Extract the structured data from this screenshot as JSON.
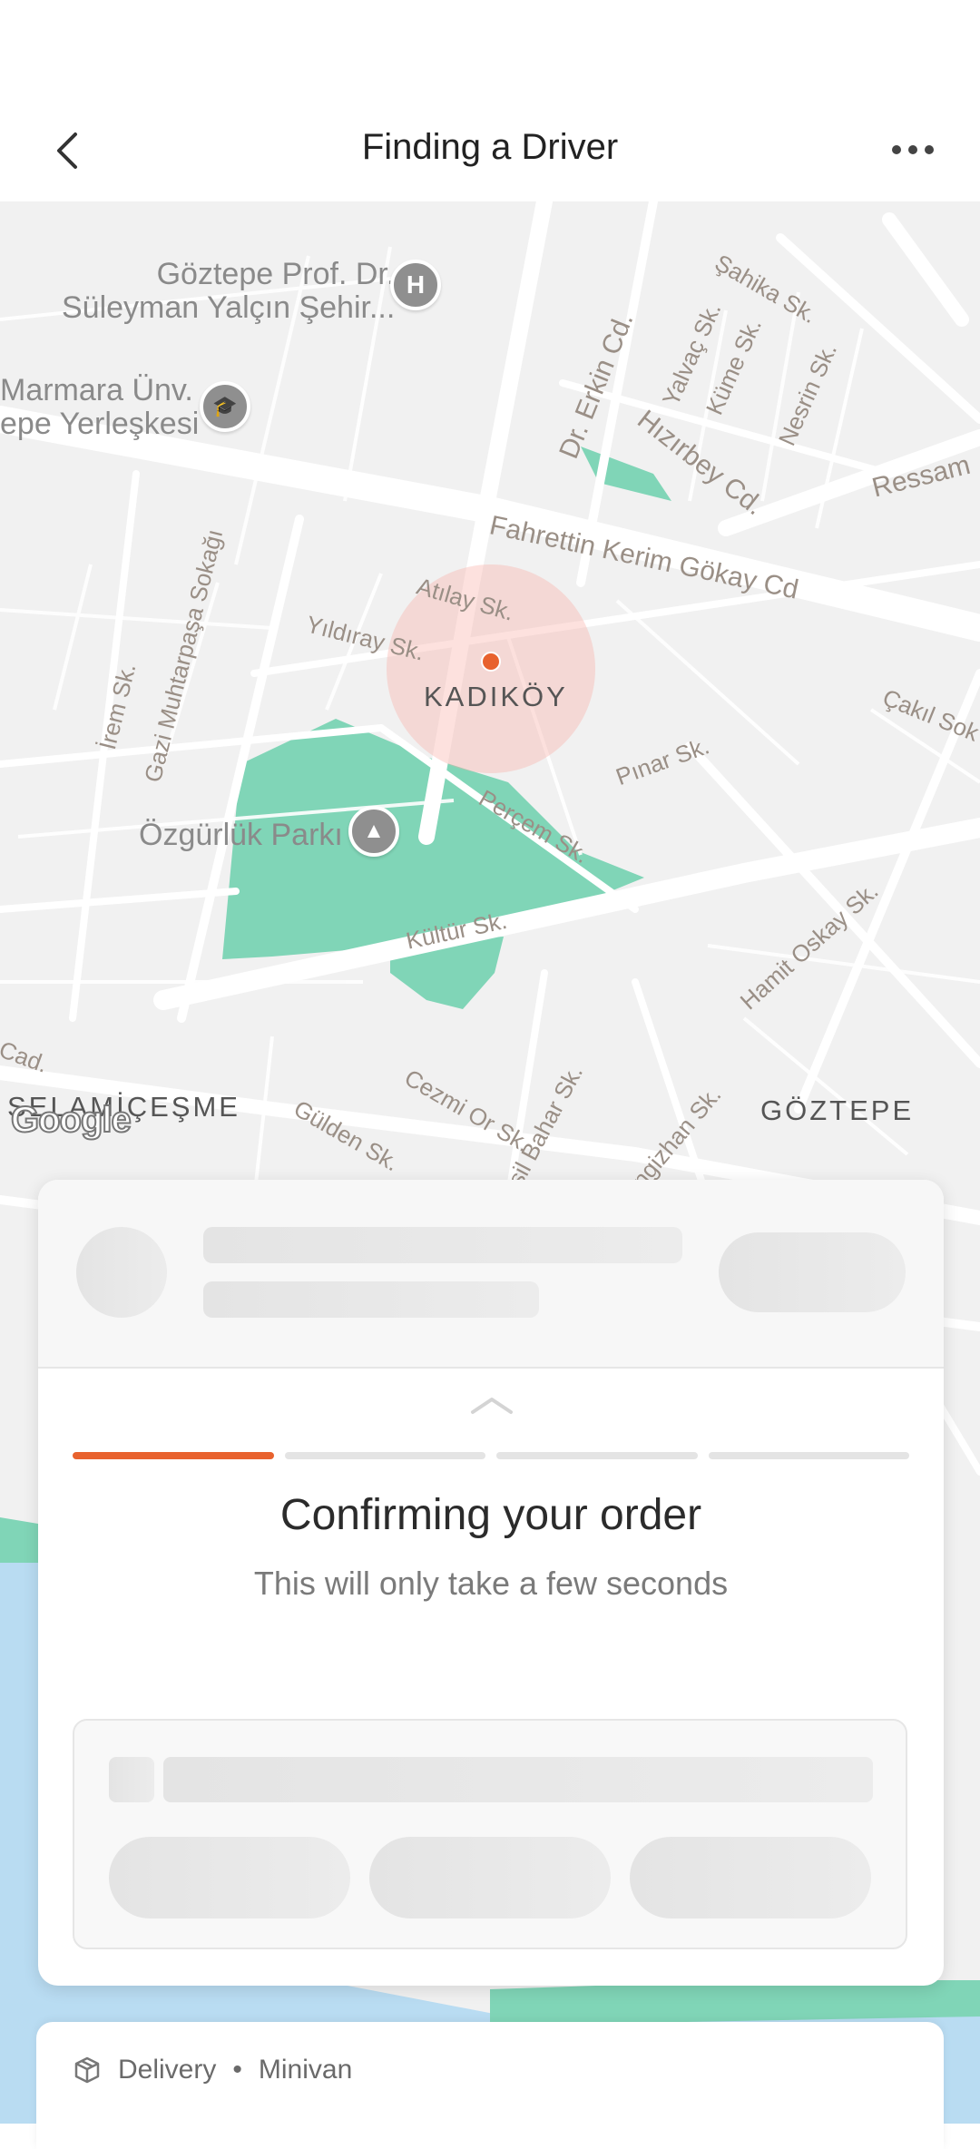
{
  "header": {
    "title": "Finding a Driver",
    "back_icon": "chevron-left-icon",
    "more_icon": "more-horizontal-icon"
  },
  "map": {
    "labels": {
      "hospital": "Göztepe Prof. Dr.\nSüleyman Yalçın Şehir...",
      "university": "Marmara Ünv.\nepe Yerleşkesi",
      "park": "Özgürlük Parkı",
      "district_kadikoy": "KADIKÖY",
      "district_selamicesme": "SELAMİÇEŞME",
      "district_goztepe": "GÖZTEPE",
      "google": "Google"
    },
    "streets": {
      "fahrettin": "Fahrettin Kerim Gökay Cd",
      "atilay": "Atılay Sk.",
      "yildiray": "Yıldıray Sk.",
      "pinar": "Pınar Sk.",
      "percem": "Perçem Sk.",
      "kultur": "Kültür Sk.",
      "cezmi": "Cezmi Or Sk.",
      "gulden": "Gülden Sk.",
      "hamit": "Hamit Oskay Sk.",
      "cakil": "Çakıl Sok",
      "hizirbey": "Hızırbey Cd.",
      "erkin": "Dr. Erkin Cd.",
      "ressam": "Ressam",
      "sahika": "Şahika Sk.",
      "yalvac": "Yalvaç Sk.",
      "kume": "Küme Sk.",
      "nesrin": "Nesrin Sk.",
      "irem": "İrem Sk.",
      "gazi": "Gazi Muhtarpaşa Sokağı",
      "yesilbahar": "eşil Bahar Sk.",
      "gizhan": "ngizhan Sk.",
      "cad": "Cad."
    },
    "colors": {
      "accent": "#e8622e",
      "park": "#80d5b7",
      "water": "#b9dcf2"
    }
  },
  "sheet": {
    "progress_steps": [
      "active",
      "pending",
      "pending",
      "pending"
    ],
    "title": "Confirming your order",
    "subtitle": "This will only take a few seconds"
  },
  "delivery": {
    "icon": "package-icon",
    "service": "Delivery",
    "separator": "•",
    "vehicle": "Minivan"
  }
}
